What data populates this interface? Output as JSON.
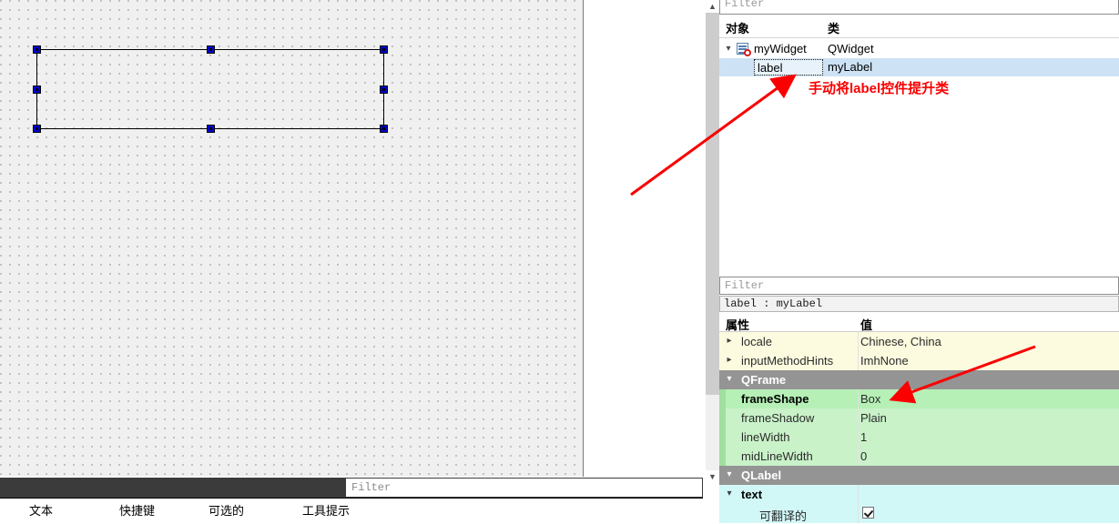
{
  "design_canvas": {
    "name": "form-design-canvas",
    "widget": {
      "selected": true,
      "handles": 8
    }
  },
  "object_inspector": {
    "filter_placeholder": "Filter",
    "columns": [
      "对象",
      "类"
    ],
    "rows": [
      {
        "object": "myWidget",
        "class": "QWidget",
        "level": 0,
        "expanded": true,
        "icon": "widget-form-icon",
        "selected": false,
        "editing": false
      },
      {
        "object": "label",
        "class": "myLabel",
        "level": 1,
        "expanded": false,
        "icon": "",
        "selected": true,
        "editing": true
      }
    ]
  },
  "property_editor": {
    "filter_placeholder": "Filter",
    "object_line": "label : myLabel",
    "columns": [
      "属性",
      "值"
    ],
    "rows": [
      {
        "name": "locale",
        "value": "Chinese, China",
        "kind": "plain",
        "expander": "chevron-right-icon",
        "indent": 1,
        "bold": false
      },
      {
        "name": "inputMethodHints",
        "value": "ImhNone",
        "kind": "plain",
        "expander": "chevron-right-icon",
        "indent": 1,
        "bold": false
      },
      {
        "name": "QFrame",
        "value": "",
        "kind": "group",
        "expander": "chevron-down-icon",
        "indent": 1,
        "bold": true
      },
      {
        "name": "frameShape",
        "value": "Box",
        "kind": "frame-sel",
        "expander": "",
        "indent": 1,
        "bold": true
      },
      {
        "name": "frameShadow",
        "value": "Plain",
        "kind": "frame",
        "expander": "",
        "indent": 1,
        "bold": false
      },
      {
        "name": "lineWidth",
        "value": "1",
        "kind": "frame",
        "expander": "",
        "indent": 1,
        "bold": false
      },
      {
        "name": "midLineWidth",
        "value": "0",
        "kind": "frame",
        "expander": "",
        "indent": 1,
        "bold": false
      },
      {
        "name": "QLabel",
        "value": "",
        "kind": "group",
        "expander": "chevron-down-icon",
        "indent": 1,
        "bold": true
      },
      {
        "name": "text",
        "value": "",
        "kind": "cyan",
        "expander": "chevron-down-icon",
        "indent": 1,
        "bold": true
      },
      {
        "name": "可翻译的",
        "value": "",
        "kind": "cyan",
        "expander": "",
        "indent": 2,
        "bold": false,
        "checkbox": true
      }
    ]
  },
  "action_editor": {
    "filter_placeholder": "Filter",
    "columns": [
      "文本",
      "快捷键",
      "可选的",
      "工具提示"
    ]
  },
  "scrollbar": {
    "up_arrow": "chevron-up-icon",
    "down_arrow": "chevron-down-icon"
  },
  "annotations": {
    "note_1": "手动将label控件提升类",
    "color": "#fa0000"
  }
}
